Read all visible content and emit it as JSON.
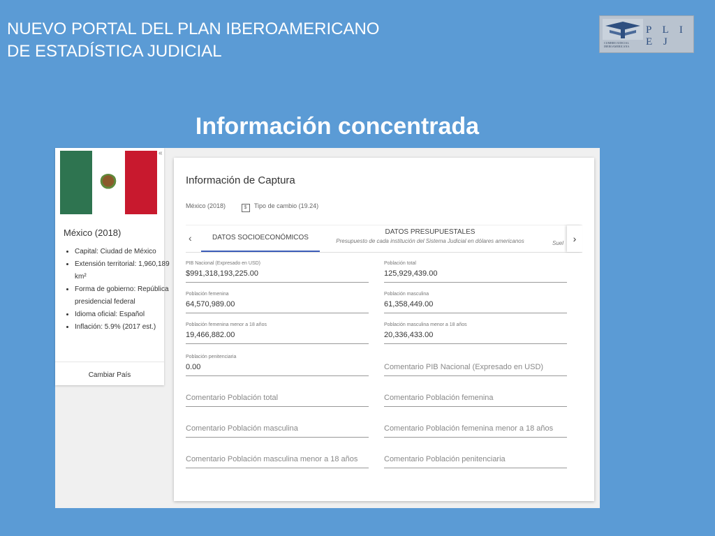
{
  "slide": {
    "title_line1": "NUEVO PORTAL DEL PLAN IBEROAMERICANO",
    "title_line2": "DE ESTADÍSTICA JUDICIAL",
    "section_heading": "Información concentrada",
    "logo_text": "P L I E J",
    "logo_subtext": "CUMBRE JUDICIAL IBEROAMERICANA"
  },
  "country_panel": {
    "collapse_icon": "«",
    "country_title": "México (2018)",
    "facts": [
      "Capital: Ciudad de México",
      "Extensión territorial: 1,960,189 km²",
      "Forma de gobierno: República presidencial federal",
      "Idioma oficial: Español",
      "Inflación: 5.9% (2017 est.)"
    ],
    "change_country_label": "Cambiar País"
  },
  "capture": {
    "title": "Información de Captura",
    "country_year": "México (2018)",
    "money_icon_glyph": "$",
    "exchange_rate": "Tipo de cambio (19.24)",
    "tabs": [
      {
        "label": "DATOS SOCIOECONÓMICOS",
        "description": ""
      },
      {
        "label": "DATOS PRESUPUESTALES",
        "description": "Presupuesto de cada institución del Sistema Judicial en dólares americanos"
      },
      {
        "label": "",
        "description": "Suel"
      }
    ],
    "arrow_left": "‹",
    "arrow_right": "›",
    "fields": [
      {
        "label": "PIB Nacional (Expresado en USD)",
        "value": "$991,318,193,225.00"
      },
      {
        "label": "Población total",
        "value": "125,929,439.00"
      },
      {
        "label": "Población femenina",
        "value": "64,570,989.00"
      },
      {
        "label": "Población masculina",
        "value": "61,358,449.00"
      },
      {
        "label": "Población femenina menor a 18 años",
        "value": "19,466,882.00"
      },
      {
        "label": "Población masculina menor a 18 años",
        "value": "20,336,433.00"
      },
      {
        "label": "Población penitenciaria",
        "value": "0.00"
      },
      {
        "placeholder": "Comentario PIB Nacional (Expresado en USD)"
      },
      {
        "placeholder": "Comentario Población total"
      },
      {
        "placeholder": "Comentario Población femenina"
      },
      {
        "placeholder": "Comentario Población masculina"
      },
      {
        "placeholder": "Comentario Población femenina menor a 18 años"
      },
      {
        "placeholder": "Comentario Población masculina menor a 18 años"
      },
      {
        "placeholder": "Comentario Población penitenciaria"
      }
    ]
  },
  "colors": {
    "slide_background": "#5b9bd5",
    "tab_active_underline": "#3b5cb8",
    "flag_green": "#2e7450",
    "flag_red": "#c8192e"
  }
}
